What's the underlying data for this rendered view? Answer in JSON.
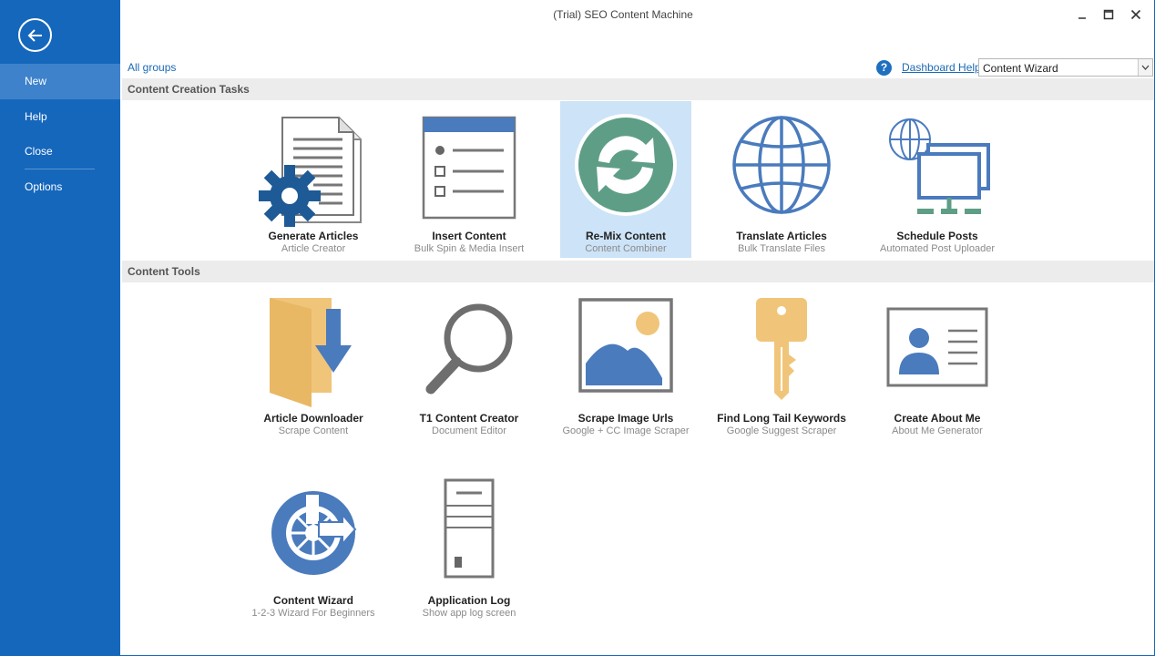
{
  "window": {
    "title": "(Trial) SEO Content Machine"
  },
  "sidebar": {
    "items": [
      {
        "label": "New"
      },
      {
        "label": "Help"
      },
      {
        "label": "Close"
      },
      {
        "label": "Options"
      }
    ]
  },
  "toolbar": {
    "all_groups": "All groups",
    "dashboard_help": "Dashboard Help",
    "help_glyph": "?",
    "dropdown_value": "Content Wizard"
  },
  "groups": [
    {
      "header": "Content Creation Tasks",
      "tiles": [
        {
          "title": "Generate Articles",
          "subtitle": "Article Creator",
          "icon": "document-gear-icon"
        },
        {
          "title": "Insert Content",
          "subtitle": "Bulk Spin & Media Insert",
          "icon": "checklist-icon"
        },
        {
          "title": "Re-Mix Content",
          "subtitle": "Content Combiner",
          "icon": "refresh-icon"
        },
        {
          "title": "Translate Articles",
          "subtitle": "Bulk Translate Files",
          "icon": "globe-icon"
        },
        {
          "title": "Schedule Posts",
          "subtitle": "Automated Post Uploader",
          "icon": "network-monitor-icon"
        }
      ]
    },
    {
      "header": "Content Tools",
      "tiles": [
        {
          "title": "Article Downloader",
          "subtitle": "Scrape Content",
          "icon": "folder-download-icon"
        },
        {
          "title": "T1 Content Creator",
          "subtitle": "Document Editor",
          "icon": "magnifier-icon"
        },
        {
          "title": "Scrape Image Urls",
          "subtitle": "Google + CC Image Scraper",
          "icon": "image-icon"
        },
        {
          "title": "Find Long Tail Keywords",
          "subtitle": "Google Suggest Scraper",
          "icon": "key-icon"
        },
        {
          "title": "Create About Me",
          "subtitle": "About Me Generator",
          "icon": "id-card-icon"
        },
        {
          "title": "Content Wizard",
          "subtitle": "1-2-3 Wizard For Beginners",
          "icon": "wizard-clock-icon"
        },
        {
          "title": "Application Log",
          "subtitle": "Show app log screen",
          "icon": "server-icon"
        }
      ]
    }
  ],
  "colors": {
    "sidebar": "#1567bc",
    "sidebar_active": "#3d82cb",
    "selected_tile": "#cde3f7",
    "accent_blue": "#4a7bbd",
    "teal": "#5e9e86",
    "tan": "#f0c57a"
  }
}
